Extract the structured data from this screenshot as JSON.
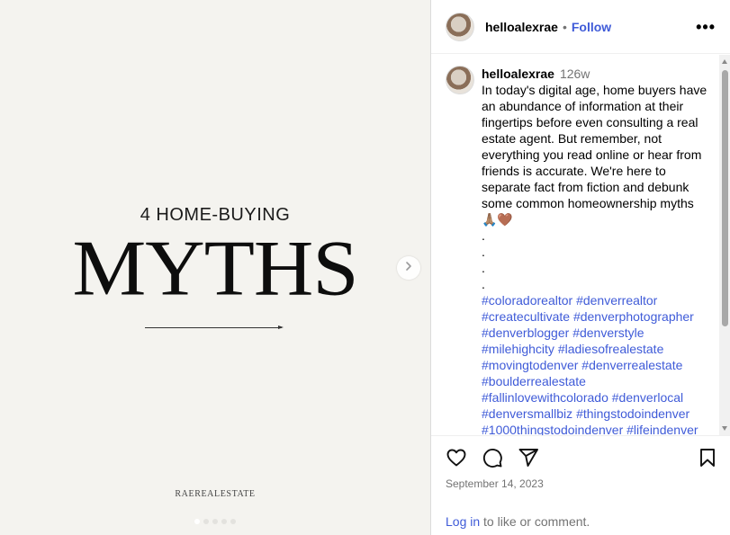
{
  "post": {
    "slide_subtitle": "4 HOME-BUYING",
    "slide_title": "MYTHS",
    "slide_brand": "RAEREALESTATE",
    "carousel_dots": 5,
    "active_dot": 0
  },
  "header": {
    "username": "helloalexrae",
    "separator": "•",
    "follow_label": "Follow",
    "more_label": "•••"
  },
  "caption": {
    "username": "helloalexrae",
    "age": "126w",
    "text": "In today's digital age, home buyers have an abundance of information at their fingertips before even consulting a real estate agent. But remember, not everything you read online or hear from friends is accurate. We're here to separate fact from fiction and debunk some common homeownership myths",
    "emoji": "🙏🏽🤎",
    "dots": [
      ".",
      ".",
      ".",
      "."
    ],
    "hashtags": [
      "#coloradorealtor",
      "#denverrealtor",
      "#createcultivate",
      "#denverphotographer",
      "#denverblogger",
      "#denverstyle",
      "#milehighcity",
      "#ladiesofrealestate",
      "#movingtodenver",
      "#denverrealestate",
      "#boulderrealestate",
      "#fallinlovewithcolorado",
      "#denverlocal",
      "#denversmallbiz",
      "#thingstodoindenver",
      "#1000thingstodoindenver",
      "#lifeindenver"
    ]
  },
  "footer": {
    "date": "September 14, 2023",
    "login_link": "Log in",
    "login_rest": " to like or comment."
  },
  "icons": {
    "like": "heart-icon",
    "comment": "comment-icon",
    "share": "share-icon",
    "save": "bookmark-icon",
    "next": "chevron-right-icon"
  }
}
